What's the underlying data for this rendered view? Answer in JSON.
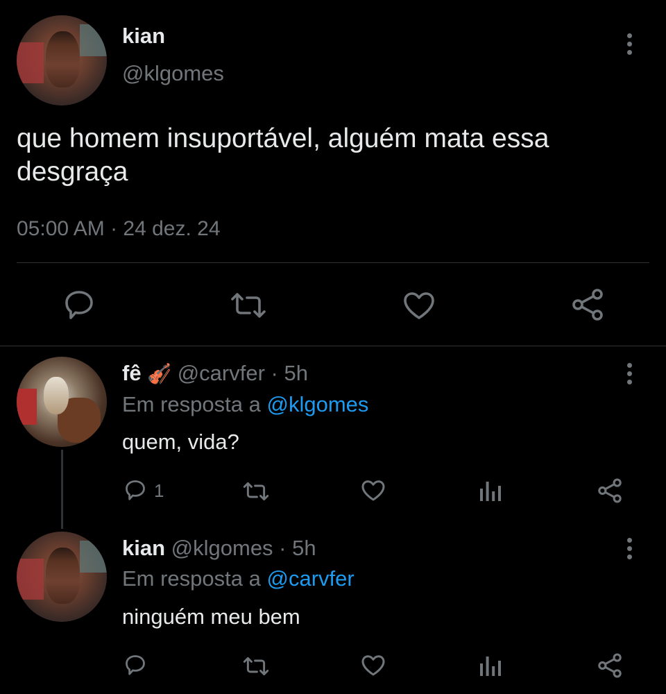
{
  "main_tweet": {
    "display_name": "kian",
    "handle": "@klgomes",
    "text_line1": "que homem insuportável, alguém mata essa",
    "text_line2": "desgraça",
    "timestamp": "05:00 AM · 24 dez. 24"
  },
  "replies": [
    {
      "display_name": "fê",
      "emoji": "🎻",
      "meta": "@carvfer · 5h",
      "replying_prefix": "Em resposta a ",
      "replying_to": "@klgomes",
      "text": "quem, vida?",
      "reply_count": "1"
    },
    {
      "display_name": "kian",
      "meta": "@klgomes · 5h",
      "replying_prefix": "Em resposta a ",
      "replying_to": "@carvfer",
      "text": "ninguém meu bem",
      "reply_count": ""
    }
  ],
  "icons": {
    "reply": "reply-icon",
    "retweet": "retweet-icon",
    "like": "heart-icon",
    "views": "views-icon",
    "share": "share-icon",
    "more": "more-vertical-icon"
  },
  "colors": {
    "background": "#000000",
    "text": "#e7e9ea",
    "muted": "#71767b",
    "link": "#1d9bf0",
    "divider": "#2f3336"
  }
}
